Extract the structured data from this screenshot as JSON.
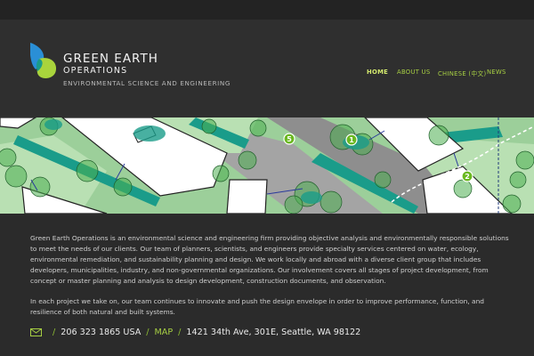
{
  "header": {
    "brand_line1": "GREEN EARTH",
    "brand_line2": "OPERATIONS",
    "tagline": "ENVIRONMENTAL SCIENCE AND ENGINEERING",
    "logo_icon": "leaf-drop-logo",
    "colors": {
      "accent": "#a7cf43",
      "nav_active": "#d4ea6e",
      "blue": "#2a8fd6",
      "teal": "#1a9c8a",
      "lime": "#a9d43c"
    }
  },
  "nav": [
    {
      "label": "HOME",
      "active": true
    },
    {
      "label": "ABOUT US",
      "active": false
    },
    {
      "label": "CHINESE (中文)",
      "active": false
    },
    {
      "label": "NEWS",
      "active": false
    }
  ],
  "banner": {
    "markers": [
      "1",
      "2",
      "5"
    ]
  },
  "body": {
    "paragraph1": "Green Earth Operations is an environmental science and engineering firm providing objective analysis and environmentally responsible solutions to meet the needs of our clients. Our team of planners, scientists, and engineers provide specialty services centered on water, ecology, environmental remediation, and sustainability planning and design. We work locally and abroad with a diverse client group that includes developers, municipalities, industry, and non-governmental organizations. Our involvement covers all stages of project development, from concept or master planning and analysis to design development, construction documents, and observation.",
    "paragraph2": "In each project we take on, our team continues to innovate and push the design envelope in order to improve performance, function, and resilience of both natural and built systems."
  },
  "contact": {
    "mail_icon": "envelope-icon",
    "separator": "/",
    "phone": "206 323 1865 USA",
    "map_label": "MAP",
    "address": "1421 34th Ave, 301E, Seattle, WA 98122"
  }
}
